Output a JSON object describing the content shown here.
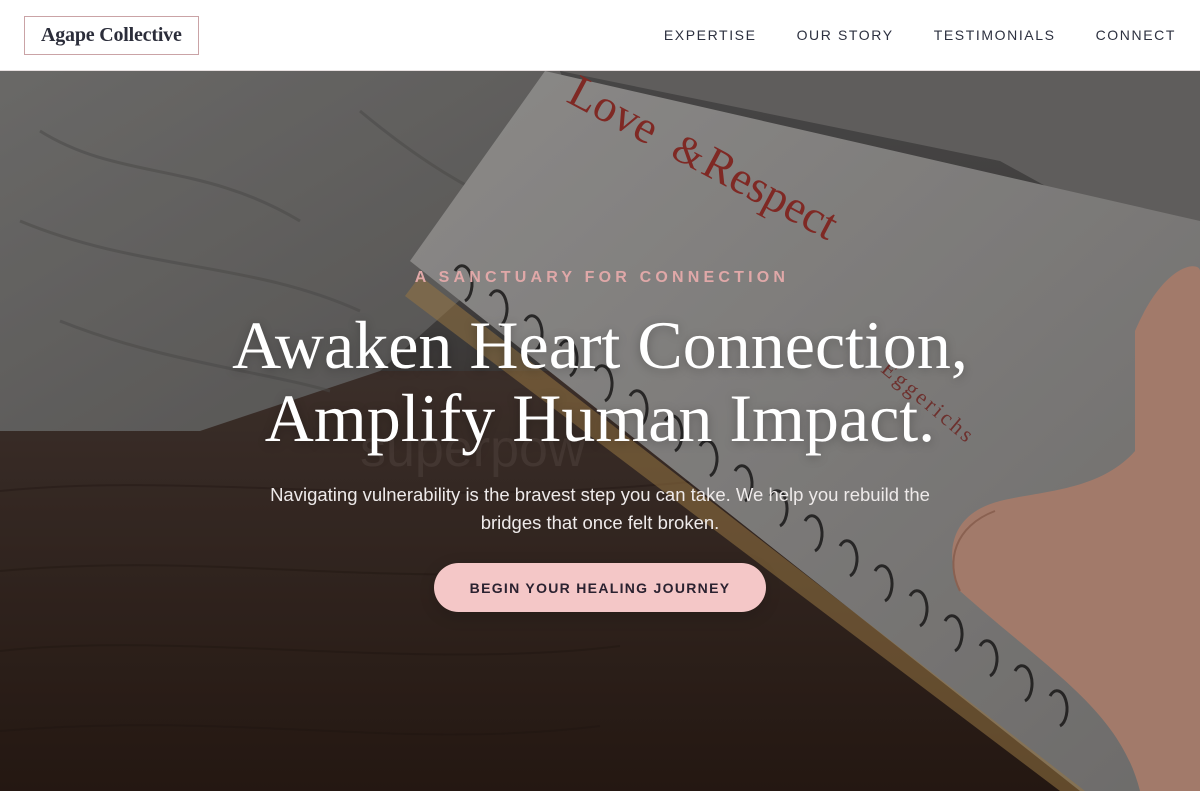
{
  "header": {
    "logo_text": "Agape Collective",
    "nav": [
      {
        "label": "EXPERTISE"
      },
      {
        "label": "OUR STORY"
      },
      {
        "label": "TESTIMONIALS"
      },
      {
        "label": "CONNECT"
      }
    ]
  },
  "hero": {
    "eyebrow": "A SANCTUARY FOR CONNECTION",
    "title_line1": "Awaken Heart Connection,",
    "title_line2": "Amplify Human Impact.",
    "subtitle": "Navigating vulnerability is the bravest step you can take. We help you rebuild the bridges that once felt broken.",
    "cta_label": "BEGIN YOUR HEALING JOURNEY",
    "photo": {
      "book_title_line1": "Love",
      "book_title_amp": "&",
      "book_title_line2": "Respect",
      "book_author_fragment": "Eggerichs",
      "faint_text": "superpow"
    }
  },
  "colors": {
    "accent_pink": "#f4c7c7",
    "eyebrow_pink": "#e0a8a8",
    "logo_border": "#caa3a6",
    "nav_text": "#2d3140",
    "book_red": "#a8322c"
  }
}
